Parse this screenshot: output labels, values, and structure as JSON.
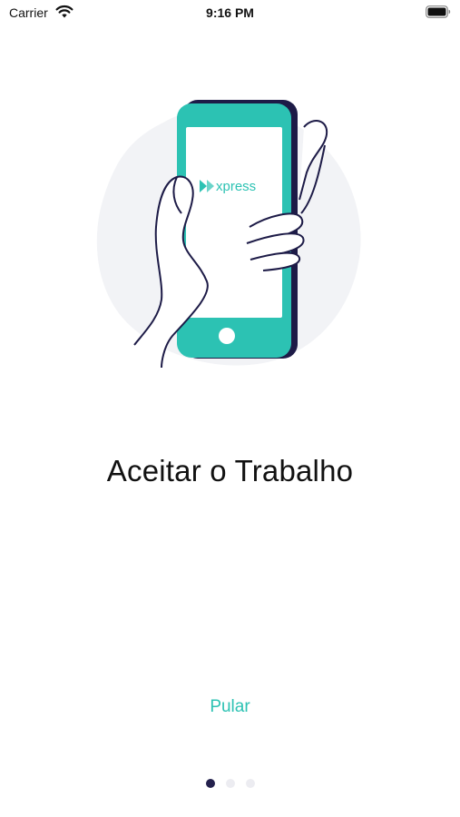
{
  "status_bar": {
    "carrier": "Carrier",
    "time": "9:16 PM",
    "icons": [
      "wifi-icon",
      "battery-icon"
    ]
  },
  "illustration": {
    "brand": "xpress",
    "icon": "phone-in-hand-illustration",
    "colors": {
      "accent": "#2cc2b3",
      "outline": "#1d1b47",
      "blob": "#f2f3f6"
    }
  },
  "onboarding": {
    "title": "Aceitar o Trabalho",
    "skip_label": "Pular",
    "pager": {
      "total": 3,
      "current": 1
    }
  },
  "colors": {
    "accent": "#2cc2b3",
    "dot_active": "#24214d",
    "dot_inactive": "#ececf1"
  }
}
